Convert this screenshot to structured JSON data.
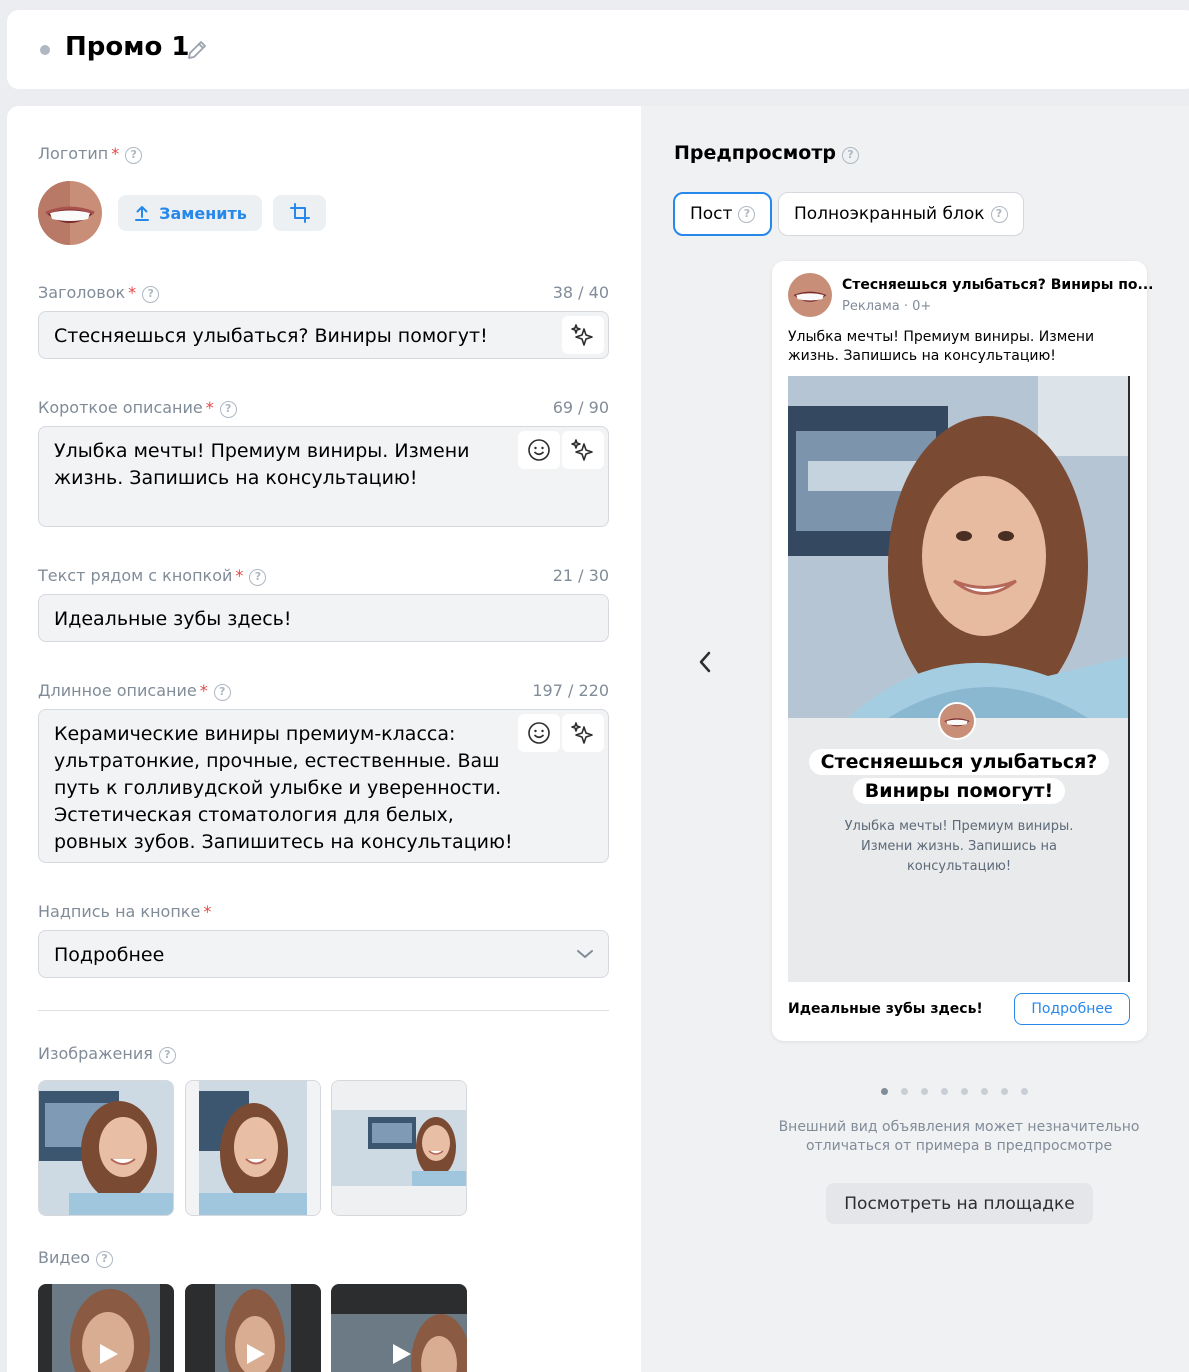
{
  "header": {
    "title": "Промо 1"
  },
  "form": {
    "logo": {
      "label": "Логотип",
      "replace_label": "Заменить"
    },
    "headline": {
      "label": "Заголовок",
      "counter": "38 / 40",
      "value": "Стесняешься улыбаться? Виниры помогут!"
    },
    "short_desc": {
      "label": "Короткое описание",
      "counter": "69 / 90",
      "value": "Улыбка мечты! Премиум виниры. Измени жизнь. Запишись на консультацию!"
    },
    "button_text": {
      "label": "Текст рядом с кнопкой",
      "counter": "21 / 30",
      "value": "Идеальные зубы здесь!"
    },
    "long_desc": {
      "label": "Длинное описание",
      "counter": "197 / 220",
      "value": "Керамические виниры премиум-класса: ультратонкие, прочные, естественные. Ваш путь к голливудской улыбке и уверенности. Эстетическая стоматология для белых, ровных зубов. Запишитесь на консультацию!"
    },
    "button_caption": {
      "label": "Надпись на кнопке",
      "value": "Подробнее"
    },
    "images": {
      "label": "Изображения"
    },
    "video": {
      "label": "Видео"
    }
  },
  "preview": {
    "title": "Предпросмотр",
    "tabs": [
      "Пост",
      "Полноэкранный блок"
    ],
    "active_tab": "Пост",
    "card": {
      "headline": "Стесняешься улыбаться? Виниры по...",
      "meta": "Реклама · 0+",
      "text": "Улыбка мечты! Премиум виниры. Измени жизнь. Запишись на консультацию!",
      "overlay_title_1": "Стесняешься улыбаться?",
      "overlay_title_2": "Виниры помогут!",
      "overlay_text": "Улыбка мечты! Премиум виниры. Измени жизнь. Запишись на консультацию!",
      "cta_text": "Идеальные зубы здесь!",
      "cta_button": "Подробнее"
    },
    "slides_total": 8,
    "slide_active": 1,
    "disclaimer": "Внешний вид объявления может незначительно отличаться от примера в предпросмотре",
    "view_button": "Посмотреть на площадке"
  },
  "colors": {
    "accent": "#2688eb",
    "required": "#e64646",
    "muted": "#818c99"
  }
}
